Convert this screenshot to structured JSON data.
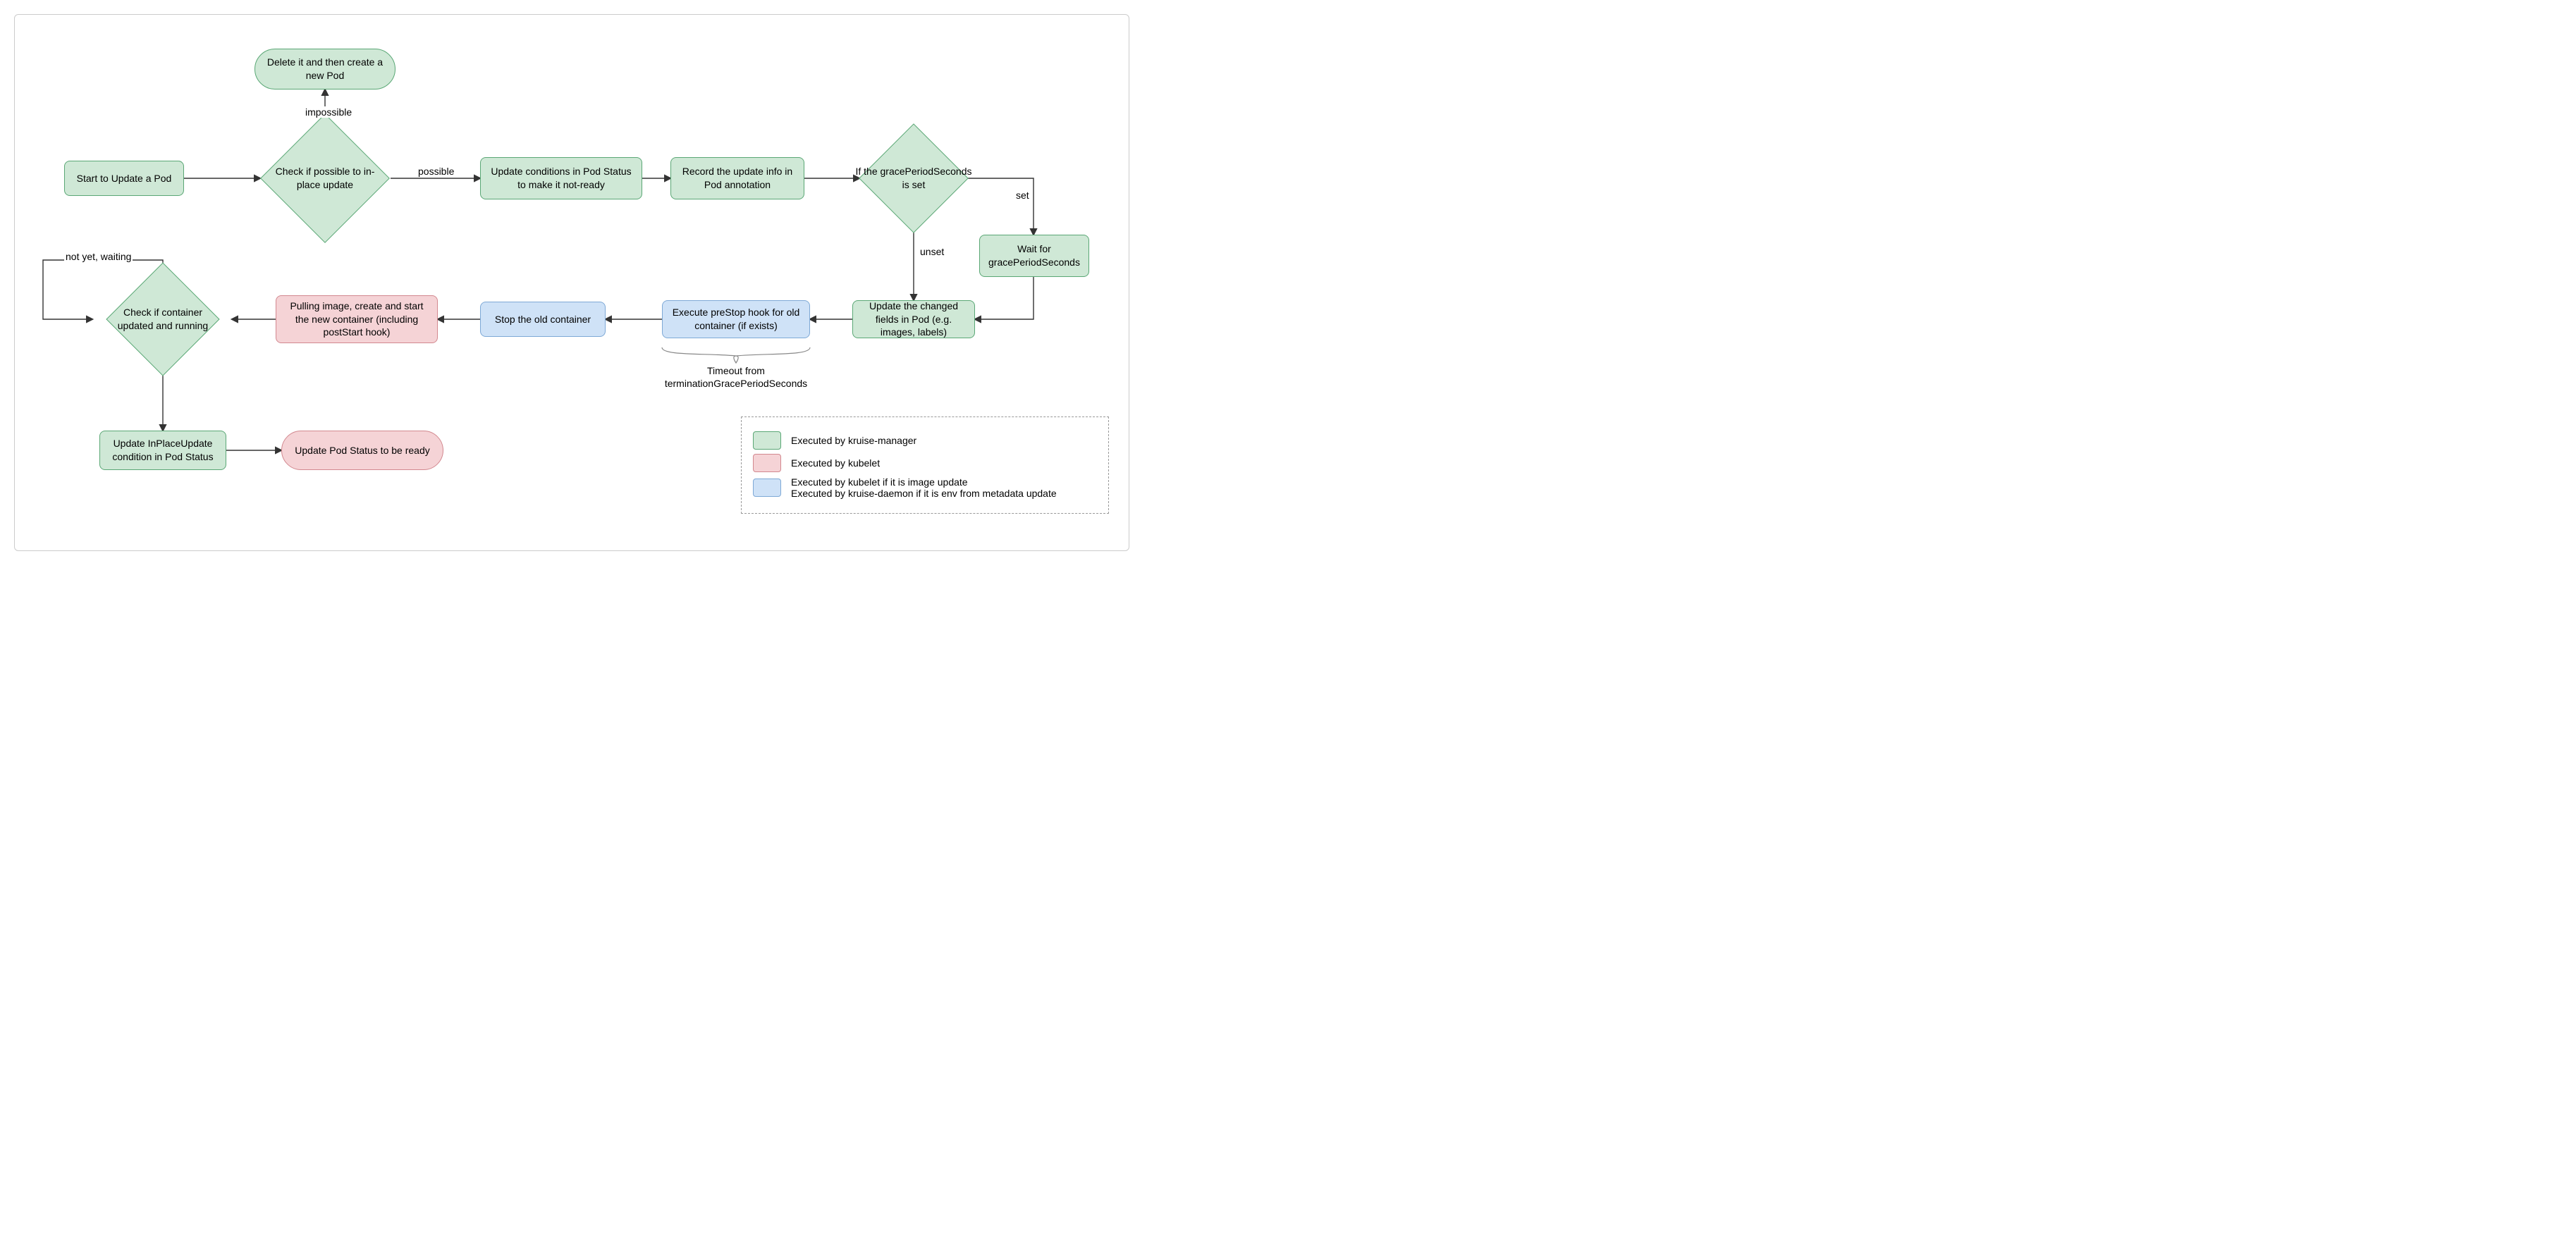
{
  "nodes": {
    "start": "Start to Update a Pod",
    "check_possible": "Check if possible to in-place update",
    "delete_new": "Delete it and then create a new Pod",
    "update_conditions": "Update conditions in Pod Status to make it not-ready",
    "record_info": "Record the update info in Pod annotation",
    "if_grace": "If the gracePeriodSeconds is set",
    "wait_grace": "Wait for gracePeriodSeconds",
    "update_fields": "Update the changed fields in Pod (e.g. images, labels)",
    "prestop": "Execute preStop hook for old container (if exists)",
    "stop_old": "Stop the old container",
    "pulling": "Pulling image, create and start the new container (including postStart hook)",
    "check_running": "Check if container updated and running",
    "update_inplace": "Update InPlaceUpdate condition in Pod Status",
    "update_ready": "Update Pod Status to be ready"
  },
  "edge_labels": {
    "impossible": "impossible",
    "possible": "possible",
    "set": "set",
    "unset": "unset",
    "waiting": "not yet, waiting"
  },
  "notes": {
    "prestop_timeout": "Timeout from terminationGracePeriodSeconds"
  },
  "legend": {
    "green": "Executed by kruise-manager",
    "pink": "Executed by kubelet",
    "blue": "Executed by kubelet if it is image update\nExecuted by kruise-daemon if it is env from metadata update"
  }
}
